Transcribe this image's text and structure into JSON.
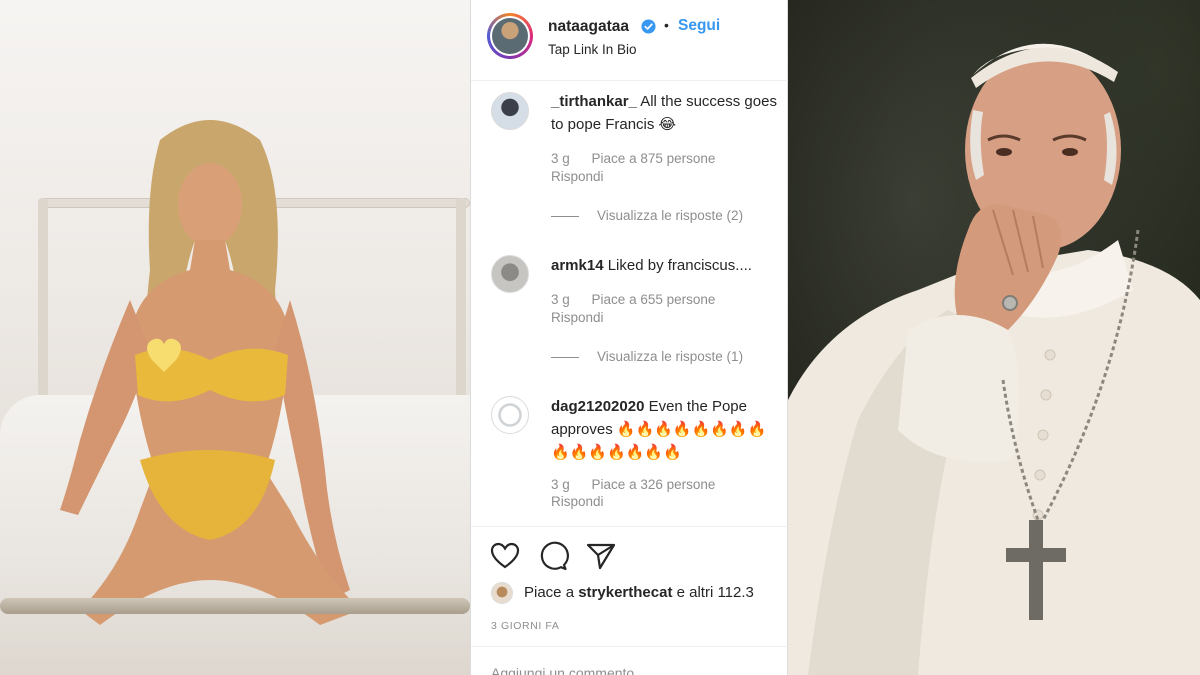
{
  "post": {
    "username": "nataagataa",
    "follow_label": "Segui",
    "separator": "•",
    "subtitle": "Tap Link In Bio"
  },
  "comments": [
    {
      "username": "_tirthankar_",
      "text": "All the success goes to pope Francis 😂",
      "age": "3 g",
      "likes": "Piace a 875 persone",
      "reply": "Rispondi",
      "view_replies": "Visualizza le risposte (2)"
    },
    {
      "username": "armk14",
      "text": "Liked by franciscus....",
      "age": "3 g",
      "likes": "Piace a 655 persone",
      "reply": "Rispondi",
      "view_replies": "Visualizza le risposte (1)"
    },
    {
      "username": "dag21202020",
      "text": "Even the Pope approves 🔥🔥🔥🔥🔥🔥🔥🔥🔥🔥🔥🔥🔥🔥🔥",
      "age": "3 g",
      "likes": "Piace a 326 persone",
      "reply": "Rispondi"
    }
  ],
  "liked_by": {
    "prefix": "Piace a",
    "user": "strykerthecat",
    "suffix": "e altri 112.3"
  },
  "date": "3 GIORNI FA",
  "add_comment_placeholder": "Aggiungi un commento...",
  "icons": {
    "like": "heart-icon",
    "comment": "comment-bubble-icon",
    "share": "paper-plane-icon",
    "verified": "verified-badge-icon"
  },
  "colors": {
    "link_blue": "#3897f0",
    "meta_gray": "#8e8e8e",
    "text_dark": "#262626"
  }
}
